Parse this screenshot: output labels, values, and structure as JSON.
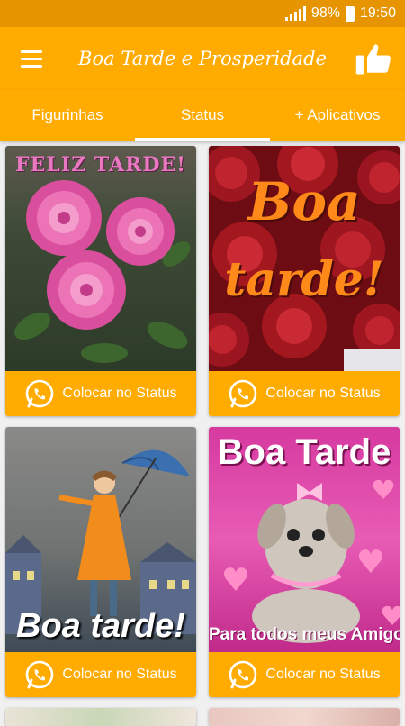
{
  "status_bar": {
    "battery": "98%",
    "time": "19:50"
  },
  "app_bar": {
    "title": "Boa Tarde e Prosperidade"
  },
  "tabs": [
    {
      "label": "Figurinhas"
    },
    {
      "label": "Status"
    },
    {
      "label": "+ Aplicativos"
    }
  ],
  "cards": [
    {
      "image_text": "FELIZ TARDE!",
      "button_label": "Colocar no Status"
    },
    {
      "image_text_line1": "Boa",
      "image_text_line2": "tarde!",
      "button_label": "Colocar no Status"
    },
    {
      "image_text": "Boa tarde!",
      "button_label": "Colocar no Status"
    },
    {
      "image_text_top": "Boa Tarde",
      "image_text_bottom": "Para todos meus Amigos",
      "button_label": "Colocar no Status"
    }
  ],
  "colors": {
    "accent": "#ffab00",
    "status_bar": "#e69500"
  }
}
